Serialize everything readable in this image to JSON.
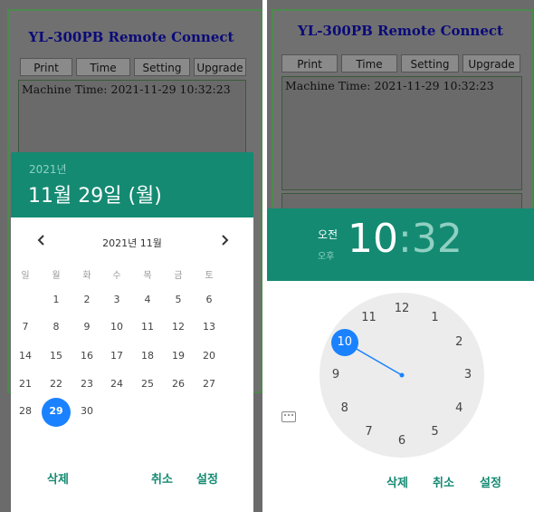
{
  "background": {
    "app_title": "YL-300PB Remote Connect",
    "buttons": [
      "Print",
      "Time",
      "Setting",
      "Upgrade"
    ],
    "machine_time": "Machine Time: 2021-11-29 10:32:23"
  },
  "date_picker": {
    "year": "2021년",
    "date_title": "11월 29일 (월)",
    "month_label": "2021년 11월",
    "prev_icon": "chevron-left",
    "next_icon": "chevron-right",
    "weekdays": [
      "일",
      "월",
      "화",
      "수",
      "목",
      "금",
      "토"
    ],
    "weeks": [
      [
        "",
        "1",
        "2",
        "3",
        "4",
        "5",
        "6"
      ],
      [
        "7",
        "8",
        "9",
        "10",
        "11",
        "12",
        "13"
      ],
      [
        "14",
        "15",
        "16",
        "17",
        "18",
        "19",
        "20"
      ],
      [
        "21",
        "22",
        "23",
        "24",
        "25",
        "26",
        "27"
      ],
      [
        "28",
        "29",
        "30",
        "",
        "",
        "",
        ""
      ]
    ],
    "selected_day": "29",
    "actions": {
      "delete": "삭제",
      "cancel": "취소",
      "set": "설정"
    }
  },
  "time_picker": {
    "am_label": "오전",
    "pm_label": "오후",
    "hour": "10",
    "separator": ":",
    "minute": "32",
    "selected_hour": "10",
    "clock_numbers": [
      "12",
      "1",
      "2",
      "3",
      "4",
      "5",
      "6",
      "7",
      "8",
      "9",
      "10",
      "11"
    ],
    "keyboard_icon": "keyboard-icon",
    "actions": {
      "delete": "삭제",
      "cancel": "취소",
      "set": "설정"
    }
  },
  "colors": {
    "header": "#148a72",
    "selection": "#1a82ff",
    "action_text": "#148a72"
  }
}
